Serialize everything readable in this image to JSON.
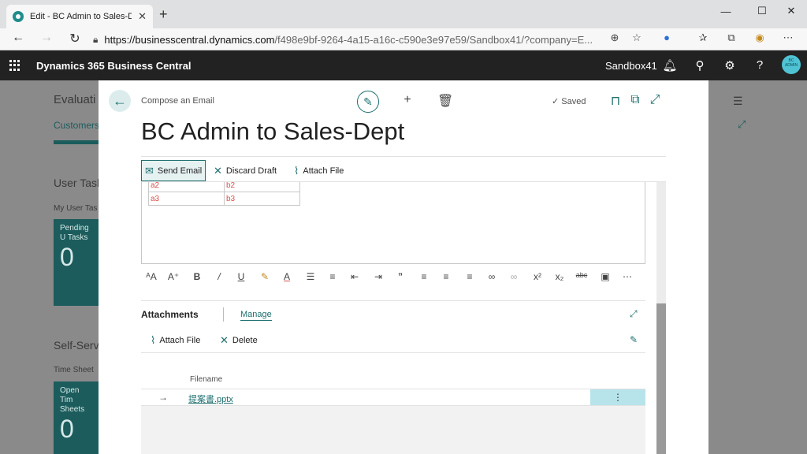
{
  "browser": {
    "tab_title": "Edit - BC Admin to Sales-Dept - ",
    "tab_close": "✕",
    "new_tab": "+",
    "url_host": "https://businesscentral.dynamics.com",
    "url_path": "/f498e9bf-9264-4a15-a16c-c590e3e97e59/Sandbox41/?company=E...",
    "controls": {
      "minimize": "—",
      "maximize": "☐",
      "close": "✕"
    }
  },
  "appbar": {
    "app_name": "Dynamics 365 Business Central",
    "environment": "Sandbox41",
    "avatar_text": "BC ADMIN"
  },
  "background": {
    "evaluation": "Evaluati",
    "customers": "Customers",
    "user_tasks": "User Task",
    "my_user_tasks": "My User Tas",
    "pending_tile_label": "Pending U Tasks",
    "pending_tile_value": "0",
    "self_service": "Self-Serv",
    "time_sheets": "Time Sheet",
    "open_tile_label": "Open Tim Sheets",
    "open_tile_value": "0"
  },
  "page": {
    "caption": "Compose an Email",
    "title": "BC Admin to Sales-Dept",
    "saved": "Saved",
    "actions": {
      "send_email": "Send Email",
      "discard_draft": "Discard Draft",
      "attach_file": "Attach File"
    },
    "editor_table": [
      [
        "a2",
        "b2"
      ],
      [
        "a3",
        "b3"
      ]
    ],
    "attachments": {
      "title": "Attachments",
      "manage": "Manage",
      "attach_file": "Attach File",
      "delete": "Delete",
      "column_filename": "Filename",
      "files": [
        {
          "name": "提案書.pptx"
        }
      ]
    }
  }
}
